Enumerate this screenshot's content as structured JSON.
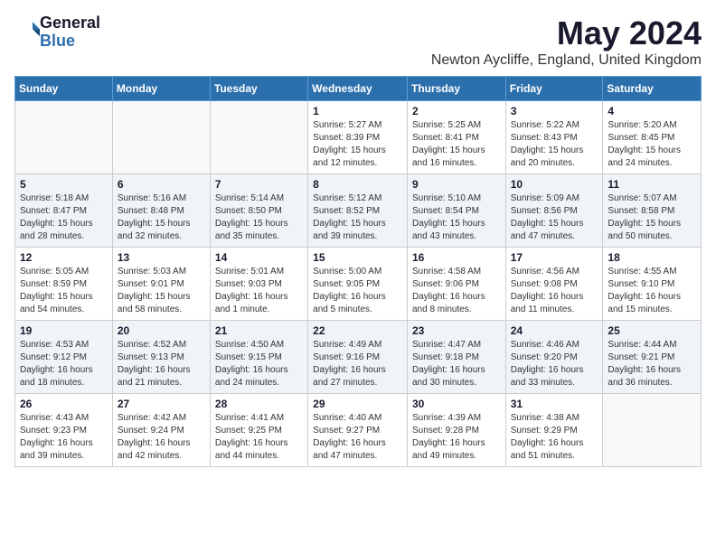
{
  "logo": {
    "general": "General",
    "blue": "Blue"
  },
  "header": {
    "month_title": "May 2024",
    "location": "Newton Aycliffe, England, United Kingdom"
  },
  "weekdays": [
    "Sunday",
    "Monday",
    "Tuesday",
    "Wednesday",
    "Thursday",
    "Friday",
    "Saturday"
  ],
  "weeks": [
    {
      "days": [
        {
          "number": "",
          "info": ""
        },
        {
          "number": "",
          "info": ""
        },
        {
          "number": "",
          "info": ""
        },
        {
          "number": "1",
          "info": "Sunrise: 5:27 AM\nSunset: 8:39 PM\nDaylight: 15 hours\nand 12 minutes."
        },
        {
          "number": "2",
          "info": "Sunrise: 5:25 AM\nSunset: 8:41 PM\nDaylight: 15 hours\nand 16 minutes."
        },
        {
          "number": "3",
          "info": "Sunrise: 5:22 AM\nSunset: 8:43 PM\nDaylight: 15 hours\nand 20 minutes."
        },
        {
          "number": "4",
          "info": "Sunrise: 5:20 AM\nSunset: 8:45 PM\nDaylight: 15 hours\nand 24 minutes."
        }
      ]
    },
    {
      "days": [
        {
          "number": "5",
          "info": "Sunrise: 5:18 AM\nSunset: 8:47 PM\nDaylight: 15 hours\nand 28 minutes."
        },
        {
          "number": "6",
          "info": "Sunrise: 5:16 AM\nSunset: 8:48 PM\nDaylight: 15 hours\nand 32 minutes."
        },
        {
          "number": "7",
          "info": "Sunrise: 5:14 AM\nSunset: 8:50 PM\nDaylight: 15 hours\nand 35 minutes."
        },
        {
          "number": "8",
          "info": "Sunrise: 5:12 AM\nSunset: 8:52 PM\nDaylight: 15 hours\nand 39 minutes."
        },
        {
          "number": "9",
          "info": "Sunrise: 5:10 AM\nSunset: 8:54 PM\nDaylight: 15 hours\nand 43 minutes."
        },
        {
          "number": "10",
          "info": "Sunrise: 5:09 AM\nSunset: 8:56 PM\nDaylight: 15 hours\nand 47 minutes."
        },
        {
          "number": "11",
          "info": "Sunrise: 5:07 AM\nSunset: 8:58 PM\nDaylight: 15 hours\nand 50 minutes."
        }
      ]
    },
    {
      "days": [
        {
          "number": "12",
          "info": "Sunrise: 5:05 AM\nSunset: 8:59 PM\nDaylight: 15 hours\nand 54 minutes."
        },
        {
          "number": "13",
          "info": "Sunrise: 5:03 AM\nSunset: 9:01 PM\nDaylight: 15 hours\nand 58 minutes."
        },
        {
          "number": "14",
          "info": "Sunrise: 5:01 AM\nSunset: 9:03 PM\nDaylight: 16 hours\nand 1 minute."
        },
        {
          "number": "15",
          "info": "Sunrise: 5:00 AM\nSunset: 9:05 PM\nDaylight: 16 hours\nand 5 minutes."
        },
        {
          "number": "16",
          "info": "Sunrise: 4:58 AM\nSunset: 9:06 PM\nDaylight: 16 hours\nand 8 minutes."
        },
        {
          "number": "17",
          "info": "Sunrise: 4:56 AM\nSunset: 9:08 PM\nDaylight: 16 hours\nand 11 minutes."
        },
        {
          "number": "18",
          "info": "Sunrise: 4:55 AM\nSunset: 9:10 PM\nDaylight: 16 hours\nand 15 minutes."
        }
      ]
    },
    {
      "days": [
        {
          "number": "19",
          "info": "Sunrise: 4:53 AM\nSunset: 9:12 PM\nDaylight: 16 hours\nand 18 minutes."
        },
        {
          "number": "20",
          "info": "Sunrise: 4:52 AM\nSunset: 9:13 PM\nDaylight: 16 hours\nand 21 minutes."
        },
        {
          "number": "21",
          "info": "Sunrise: 4:50 AM\nSunset: 9:15 PM\nDaylight: 16 hours\nand 24 minutes."
        },
        {
          "number": "22",
          "info": "Sunrise: 4:49 AM\nSunset: 9:16 PM\nDaylight: 16 hours\nand 27 minutes."
        },
        {
          "number": "23",
          "info": "Sunrise: 4:47 AM\nSunset: 9:18 PM\nDaylight: 16 hours\nand 30 minutes."
        },
        {
          "number": "24",
          "info": "Sunrise: 4:46 AM\nSunset: 9:20 PM\nDaylight: 16 hours\nand 33 minutes."
        },
        {
          "number": "25",
          "info": "Sunrise: 4:44 AM\nSunset: 9:21 PM\nDaylight: 16 hours\nand 36 minutes."
        }
      ]
    },
    {
      "days": [
        {
          "number": "26",
          "info": "Sunrise: 4:43 AM\nSunset: 9:23 PM\nDaylight: 16 hours\nand 39 minutes."
        },
        {
          "number": "27",
          "info": "Sunrise: 4:42 AM\nSunset: 9:24 PM\nDaylight: 16 hours\nand 42 minutes."
        },
        {
          "number": "28",
          "info": "Sunrise: 4:41 AM\nSunset: 9:25 PM\nDaylight: 16 hours\nand 44 minutes."
        },
        {
          "number": "29",
          "info": "Sunrise: 4:40 AM\nSunset: 9:27 PM\nDaylight: 16 hours\nand 47 minutes."
        },
        {
          "number": "30",
          "info": "Sunrise: 4:39 AM\nSunset: 9:28 PM\nDaylight: 16 hours\nand 49 minutes."
        },
        {
          "number": "31",
          "info": "Sunrise: 4:38 AM\nSunset: 9:29 PM\nDaylight: 16 hours\nand 51 minutes."
        },
        {
          "number": "",
          "info": ""
        }
      ]
    }
  ]
}
